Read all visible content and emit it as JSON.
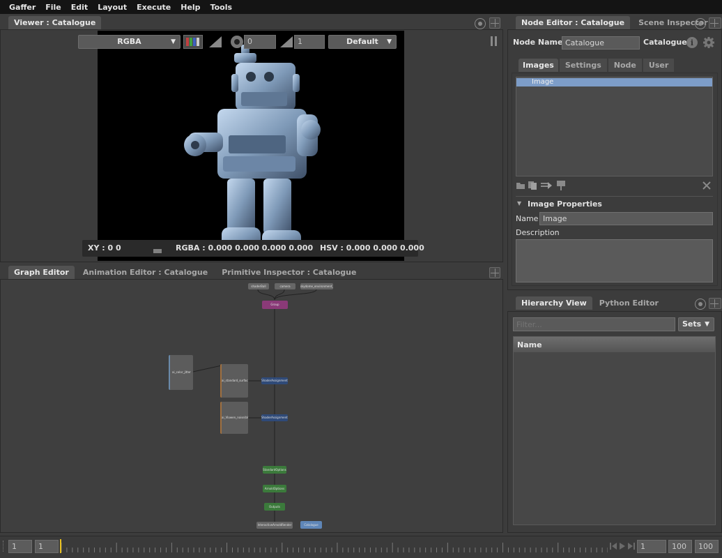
{
  "menu": [
    "Gaffer",
    "File",
    "Edit",
    "Layout",
    "Execute",
    "Help",
    "Tools"
  ],
  "viewer": {
    "tab": "Viewer : Catalogue",
    "channel": "RGBA",
    "exposure": "0",
    "gamma": "1",
    "display": "Default",
    "xy": "XY : 0 0",
    "rgba": "RGBA : 0.000 0.000 0.000 0.000",
    "hsv": "HSV : 0.000 0.000 0.000"
  },
  "bottom_tabs": [
    "Graph Editor",
    "Animation Editor : Catalogue",
    "Primitive Inspector : Catalogue"
  ],
  "graph": {
    "nodes": [
      {
        "label": "shaderBall",
        "kind": "gray"
      },
      {
        "label": "camera",
        "kind": "gray"
      },
      {
        "label": "skydome_environment_ball",
        "kind": "gray"
      },
      {
        "label": "Group",
        "kind": "purple"
      },
      {
        "label": "ai_color_jitter",
        "kind": "box"
      },
      {
        "label": "ai_standard_surface",
        "kind": "box"
      },
      {
        "label": "ShaderAssignment",
        "kind": "blue"
      },
      {
        "label": "ai_Vlowen_noise(bl)",
        "kind": "box"
      },
      {
        "label": "ShaderAssignment1",
        "kind": "blue"
      },
      {
        "label": "StandardOptions",
        "kind": "green"
      },
      {
        "label": "ArnoldOptions",
        "kind": "green"
      },
      {
        "label": "Outputs",
        "kind": "green"
      },
      {
        "label": "InteractiveArnoldRender",
        "kind": "gray"
      },
      {
        "label": "Catalogue",
        "kind": "lightblue"
      }
    ]
  },
  "node_editor": {
    "tabs": [
      "Node Editor : Catalogue",
      "Scene Inspector"
    ],
    "node_name_label": "Node Name",
    "node_name": "Catalogue",
    "node_type": "Catalogue",
    "subtabs": [
      "Images",
      "Settings",
      "Node",
      "User"
    ],
    "images": [
      "Image"
    ],
    "props_header": "Image Properties",
    "name_label": "Name",
    "name_value": "Image",
    "description_label": "Description"
  },
  "hierarchy": {
    "tabs": [
      "Hierarchy View",
      "Python Editor"
    ],
    "filter_placeholder": "Filter...",
    "sets_label": "Sets",
    "column_header": "Name"
  },
  "timeline": {
    "start": "1",
    "current": "1",
    "frame": "1",
    "end": "100",
    "end2": "100"
  }
}
